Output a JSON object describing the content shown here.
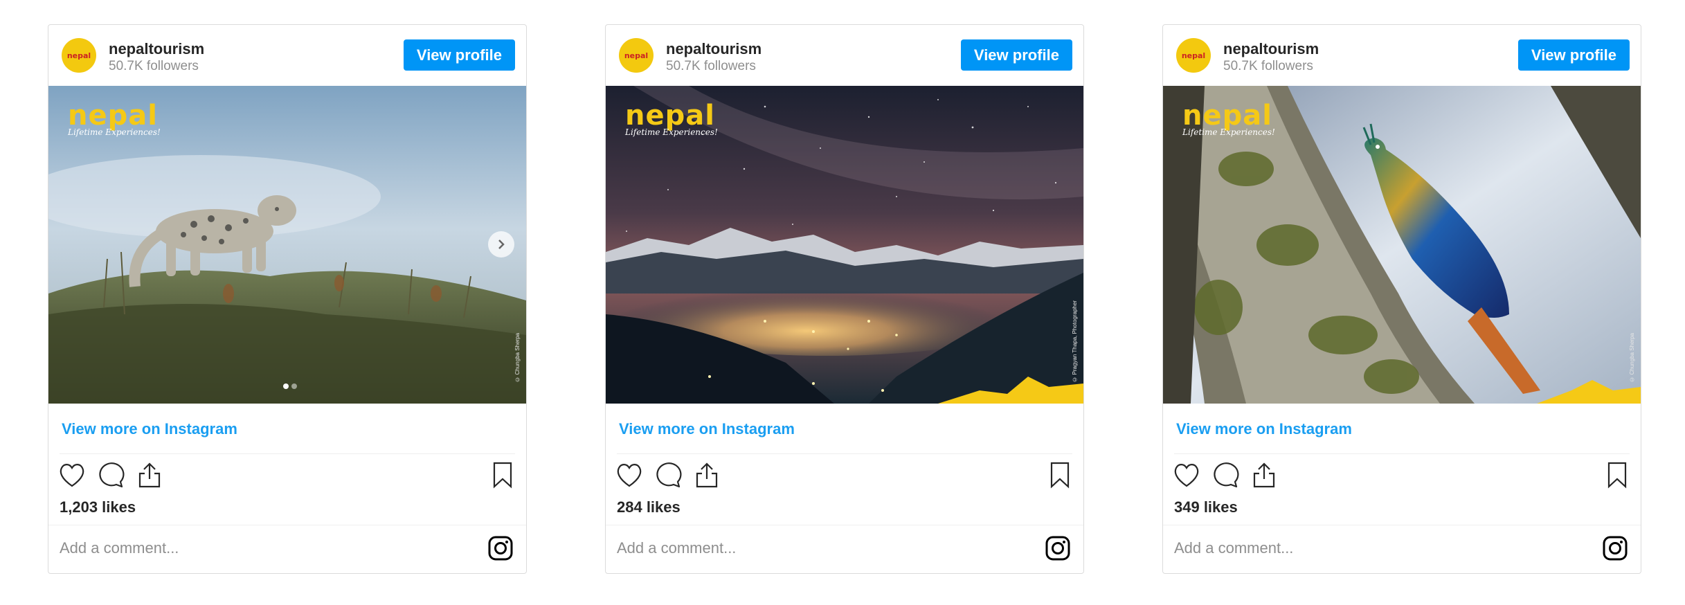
{
  "posts": [
    {
      "account": {
        "username": "nepaltourism",
        "followers": "50.7K followers",
        "avatar_text": "nepal"
      },
      "view_profile_label": "View profile",
      "photo": {
        "subject": "snow leopard on grassy ridge",
        "logo_word": "nepal",
        "logo_tagline": "Lifetime Experiences!",
        "credit": "© Chungba Sherpa",
        "carousel_slides": 2,
        "current_slide": 1
      },
      "view_more_label": "View more on Instagram",
      "likes": "1,203 likes",
      "comment_placeholder": "Add a comment..."
    },
    {
      "account": {
        "username": "nepaltourism",
        "followers": "50.7K followers",
        "avatar_text": "nepal"
      },
      "view_profile_label": "View profile",
      "photo": {
        "subject": "milky way night sky over mountain valley",
        "logo_word": "nepal",
        "logo_tagline": "Lifetime Experiences!",
        "credit": "© Pragyan Thapa, Photographer"
      },
      "view_more_label": "View more on Instagram",
      "likes": "284 likes",
      "comment_placeholder": "Add a comment..."
    },
    {
      "account": {
        "username": "nepaltourism",
        "followers": "50.7K followers",
        "avatar_text": "nepal"
      },
      "view_profile_label": "View profile",
      "photo": {
        "subject": "himalayan monal on mossy tree branch",
        "logo_word": "nepal",
        "logo_tagline": "Lifetime Experiences!",
        "credit": "© Chungba Sherpa"
      },
      "view_more_label": "View more on Instagram",
      "likes": "349 likes",
      "comment_placeholder": "Add a comment..."
    }
  ],
  "colors": {
    "button_blue": "#0095f6",
    "link_blue": "#1a9ef1",
    "logo_yellow": "#f5c916",
    "border": "#dbdbdb"
  },
  "icons": [
    "heart-icon",
    "comment-icon",
    "share-icon",
    "bookmark-icon",
    "instagram-icon",
    "chevron-right-icon"
  ]
}
